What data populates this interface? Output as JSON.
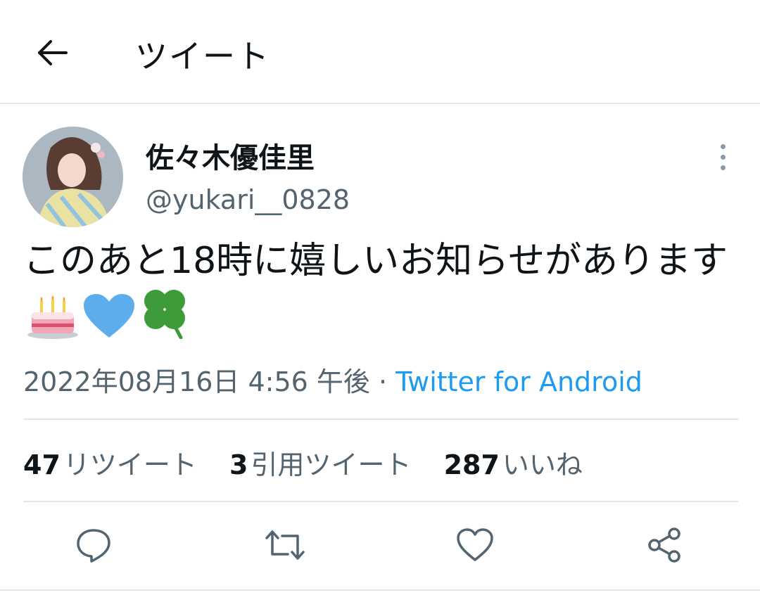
{
  "header": {
    "title": "ツイート",
    "back_icon": "arrow-left-icon"
  },
  "tweet": {
    "display_name": "佐々木優佳里",
    "handle": "@yukari__0828",
    "text": "このあと18時に嬉しいお知らせがあります",
    "emojis": [
      "birthday-cake-icon",
      "blue-heart-icon",
      "four-leaf-clover-icon"
    ],
    "timestamp": "2022年08月16日 4:56 午後",
    "separator": "·",
    "source": "Twitter for Android"
  },
  "stats": {
    "retweets": {
      "count": "47",
      "label": "リツイート"
    },
    "quotes": {
      "count": "3",
      "label": "引用ツイート"
    },
    "likes": {
      "count": "287",
      "label": "いいね"
    }
  },
  "colors": {
    "link": "#1d9bf0",
    "secondary": "#536471",
    "heart": "#5dadec",
    "clover": "#3e9b3a"
  }
}
